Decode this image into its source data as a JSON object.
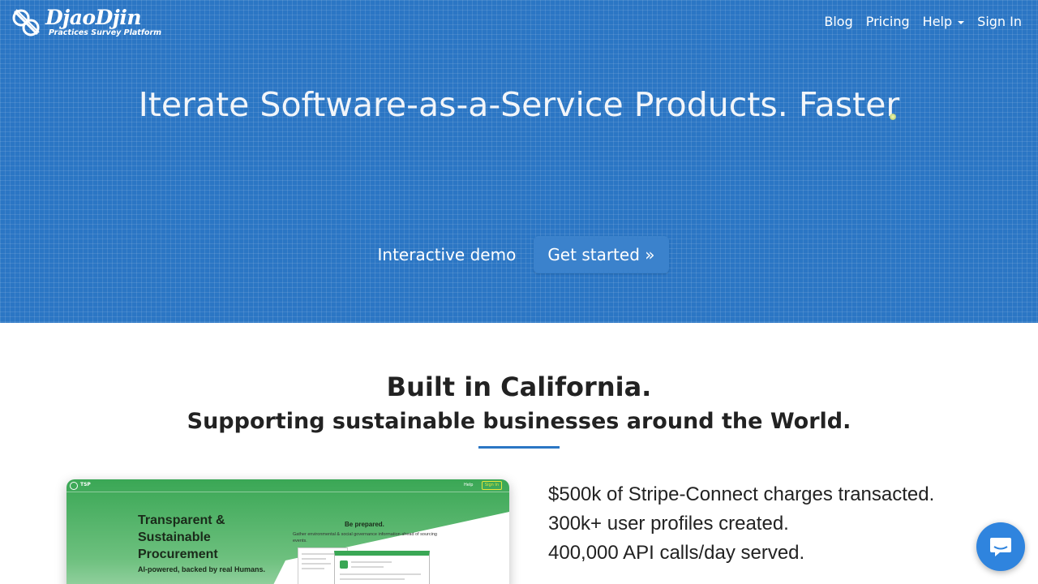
{
  "header": {
    "logo_name": "DjaoDjin",
    "logo_tagline": "Practices Survey Platform",
    "nav": [
      {
        "label": "Blog"
      },
      {
        "label": "Pricing"
      },
      {
        "label": "Help"
      },
      {
        "label": "Sign In"
      }
    ]
  },
  "hero": {
    "title": "Iterate Software-as-a-Service Products. Faster",
    "demo_label": "Interactive demo",
    "get_started_label": "Get started »"
  },
  "section": {
    "title": "Built in California.",
    "subtitle": "Supporting sustainable businesses around the World.",
    "preview": {
      "brand": "TSP",
      "help": "Help",
      "sign_in": "Sign In",
      "headline": "Transparent & Sustainable Procurement",
      "tagline": "AI-powered, backed by real Humans.",
      "be_prepared": "Be prepared.",
      "gather_text": "Gather environmental & social governance information ahead of sourcing events."
    },
    "stats": [
      "$500k of Stripe-Connect charges transacted.",
      "300k+ user profiles created.",
      "400,000 API calls/day served."
    ]
  },
  "chat": {
    "icon": "chat-bubble-icon"
  },
  "colors": {
    "hero_bg": "#2b76c4",
    "accent": "#2b76c4",
    "chat": "#2f84de"
  }
}
